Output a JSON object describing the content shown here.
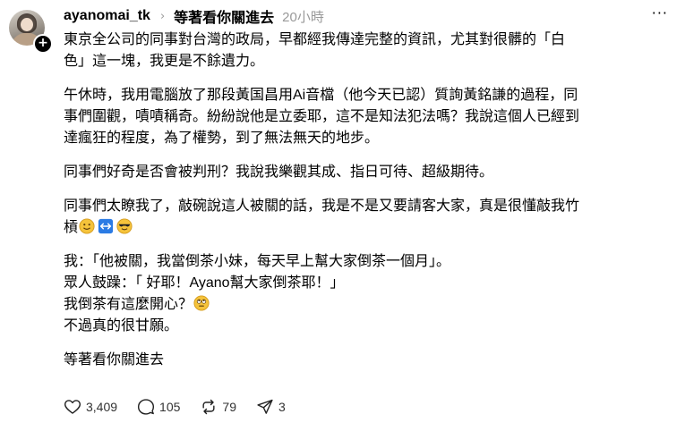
{
  "post": {
    "username": "ayanomai_tk",
    "topic": "等著看你關進去",
    "time": "20小時",
    "paragraphs": [
      [
        "東京全公司的同事對台灣的政局，早都經我傳達完整的資訊，尤其對很髒的「白",
        "色」這一塊，我更是不餘遺力。"
      ],
      [
        "午休時，我用電腦放了那段黃国昌用Ai音檔（他今天已認）質詢黃銘謙的過程，同",
        "事們圍觀，嘖嘖稱奇。紛紛說他是立委耶，這不是知法犯法嗎？我說這個人已經到",
        "達瘋狂的程度，為了權勢，到了無法無天的地步。"
      ],
      [
        "同事們好奇是否會被判刑？我說我樂觀其成、指日可待、超級期待。"
      ],
      [
        "同事們太瞭我了，敲碗說這人被關的話，我是不是又要請客大家，真是很懂敲我竹",
        "槓"
      ],
      [
        "我：「他被關，我當倒茶小妹，每天早上幫大家倒茶一個月」。",
        "眾人鼓躁：「 好耶！Ayano幫大家倒茶耶！」",
        "我倒茶有這麼開心？",
        "不過真的很甘願。"
      ],
      [
        "等著看你關進去"
      ]
    ]
  },
  "icons": {
    "follow": "+",
    "chevron": "›",
    "more": "···",
    "emojis": [
      "slightly-smiling-face",
      "left-right-arrow",
      "smiling-face-with-sunglasses",
      "face-with-rolling-eyes"
    ]
  },
  "stats": {
    "likes": "3,409",
    "replies": "105",
    "reposts": "79",
    "shares": "3"
  },
  "colors": {
    "text": "#000000",
    "muted": "#999999",
    "emoji_yellow": "#f5c33b",
    "arrow_blue": "#2b7be4"
  }
}
